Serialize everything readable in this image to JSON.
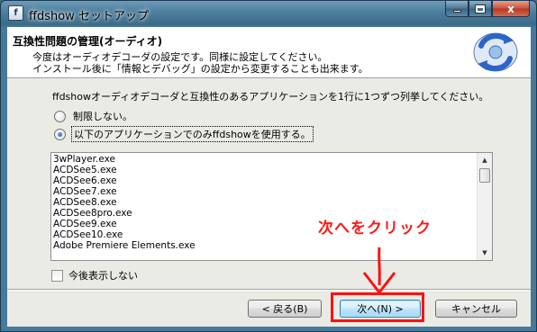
{
  "window": {
    "title": "ffdshow セットアップ",
    "app_icon_glyph": "f",
    "controls": {
      "minimize": "minimize",
      "maximize": "maximize",
      "close": "x"
    }
  },
  "header": {
    "title": "互換性問題の管理(オーディオ)",
    "description_line1": "今度はオーディオデコーダの設定です。同様に設定してください。",
    "description_line2": "インストール後に「情報とデバッグ」の設定から変更することも出来ます。",
    "logo_icon": "ffdshow-logo-icon"
  },
  "instruction": "ffdshowオーディオデコーダと互換性のあるアプリケーションを1行に1つずつ列挙してください。",
  "options": [
    {
      "label": "制限しない。",
      "checked": false
    },
    {
      "label": "以下のアプリケーションでのみffdshowを使用する。",
      "checked": true
    }
  ],
  "app_list": [
    "3wPlayer.exe",
    "ACDSee5.exe",
    "ACDSee6.exe",
    "ACDSee7.exe",
    "ACDSee8.exe",
    "ACDSee8pro.exe",
    "ACDSee9.exe",
    "ACDSee10.exe",
    "Adobe Premiere Elements.exe"
  ],
  "dont_show_again": {
    "label": "今後表示しない",
    "checked": false
  },
  "buttons": {
    "back": "< 戻る(B)",
    "next": "次へ(N) >",
    "cancel": "キャンセル"
  },
  "annotation": {
    "text": "次へをクリック",
    "color": "#ff1a1a"
  }
}
